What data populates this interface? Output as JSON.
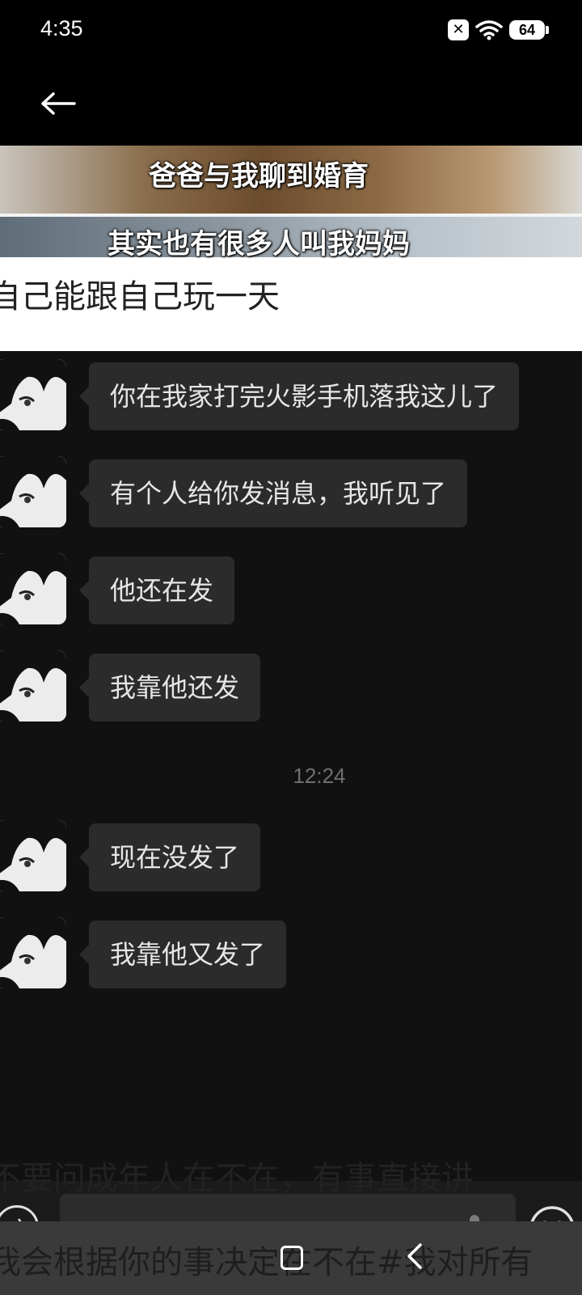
{
  "status_bar": {
    "time": "4:35",
    "battery": "64",
    "icons": [
      "notification-x-icon",
      "wifi-icon",
      "battery-icon"
    ]
  },
  "nav": {
    "back_icon": "arrow-left-icon"
  },
  "meme": {
    "caption_top": "爸爸与我聊到婚育",
    "caption_bottom": "其实也有很多人叫我妈妈"
  },
  "post": {
    "line1": "自己能跟自己玩一天",
    "line2": "不要问成年人在不在，有事直接讲",
    "line3": "我会根据你的事决定在不在#我对所有"
  },
  "chat": {
    "messages_before": [
      {
        "text": "你在我家打完火影手机落我这儿了"
      },
      {
        "text": "有个人给你发消息，我听见了"
      },
      {
        "text": "他还在发"
      },
      {
        "text": "我靠他还发"
      }
    ],
    "timestamp": "12:24",
    "messages_after": [
      {
        "text": "现在没发了"
      },
      {
        "text": "我靠他又发了"
      }
    ],
    "input": {
      "value": "",
      "icons": [
        "voice-icon",
        "microphone-icon",
        "emoji-icon"
      ]
    }
  },
  "system_nav": {
    "icons": [
      "home-icon",
      "back-chevron-icon"
    ]
  },
  "colors": {
    "chat_bg": "#111111",
    "bubble_bg": "#2b2b2b",
    "bubble_text": "#e6e6e6",
    "page_bg": "#ffffff"
  }
}
